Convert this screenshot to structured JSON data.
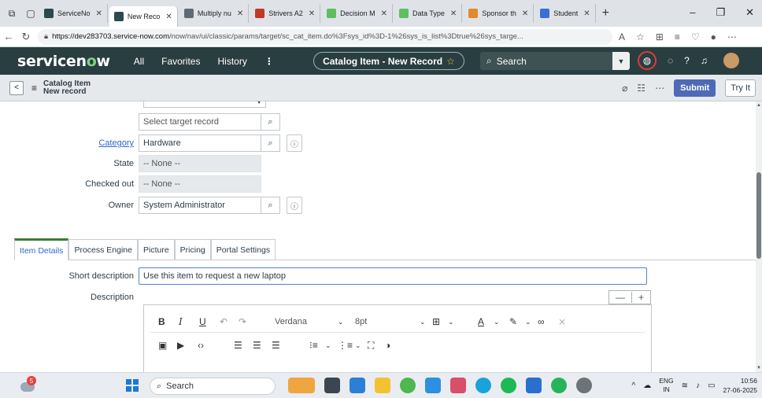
{
  "browser": {
    "tabs": [
      {
        "title": "ServiceNo",
        "color": "#2c4a4d"
      },
      {
        "title": "New Reco",
        "color": "#2c4a4d",
        "active": true
      },
      {
        "title": "Multiply nu",
        "color": "#5f6b73"
      },
      {
        "title": "Strivers A2",
        "color": "#c0392b"
      },
      {
        "title": "Decision M",
        "color": "#5fbf5f"
      },
      {
        "title": "Data Type",
        "color": "#5fbf5f"
      },
      {
        "title": "Sponsor th",
        "color": "#e08a2c"
      },
      {
        "title": "Student",
        "color": "#3a6fd6"
      }
    ],
    "url_host": "https://dev283703.service-now.com",
    "url_path": "/now/nav/ui/classic/params/target/sc_cat_item.do%3Fsys_id%3D-1%26sys_is_list%3Dtrue%26sys_targe..."
  },
  "sn": {
    "logo_pre": "servicen",
    "logo_o": "o",
    "logo_post": "w",
    "menu": [
      "All",
      "Favorites",
      "History"
    ],
    "context_title": "Catalog Item - New Record",
    "search_placeholder": "Search"
  },
  "form": {
    "title_line1": "Catalog Item",
    "title_line2": "New record",
    "submit_label": "Submit",
    "tryit_label": "Try It",
    "fields": {
      "target_placeholder": "Select target record",
      "category_label": "Category",
      "category_value": "Hardware",
      "state_label": "State",
      "state_value": "-- None --",
      "checked_out_label": "Checked out",
      "checked_out_value": "-- None --",
      "owner_label": "Owner",
      "owner_value": "System Administrator"
    },
    "tabs": [
      "Item Details",
      "Process Engine",
      "Picture",
      "Pricing",
      "Portal Settings"
    ],
    "short_description_label": "Short description",
    "short_description_value": "Use this item to request a new laptop",
    "description_label": "Description",
    "editor": {
      "font_family": "Verdana",
      "font_size": "8pt"
    }
  },
  "taskbar": {
    "search_label": "Search",
    "lang_line1": "ENG",
    "lang_line2": "IN",
    "time": "10:56",
    "date": "27-06-2025",
    "badge": "5"
  }
}
